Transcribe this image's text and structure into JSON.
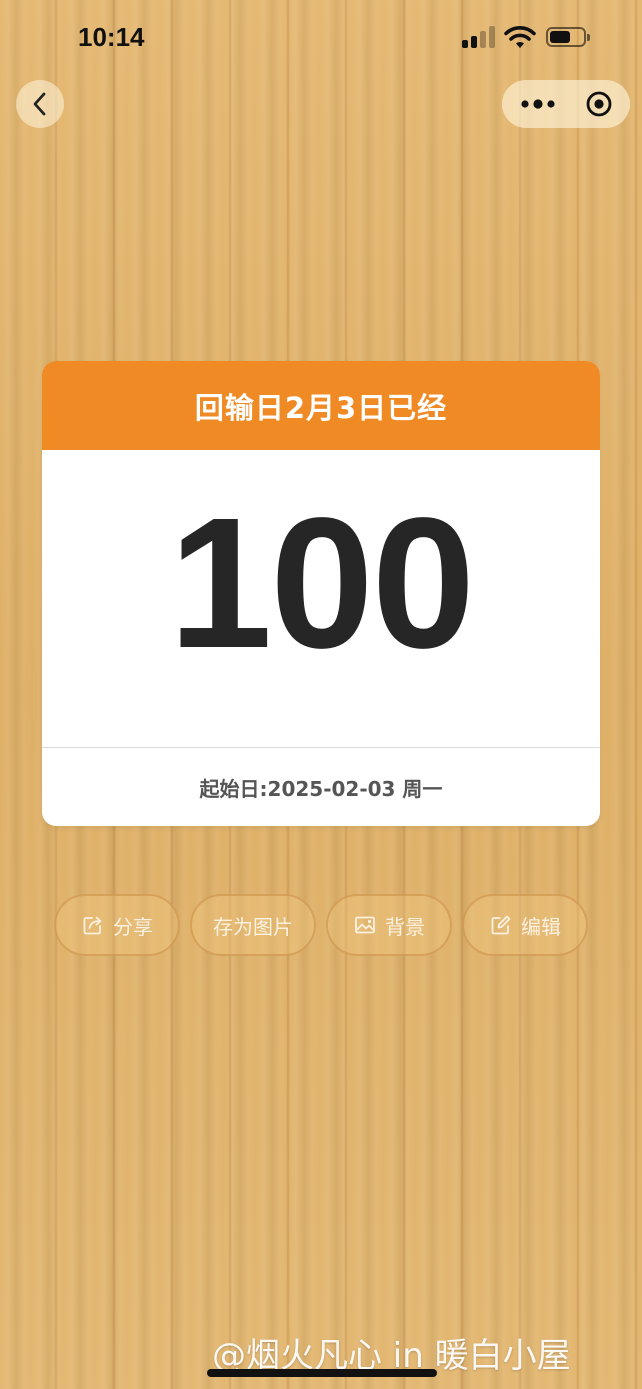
{
  "status_bar": {
    "time": "10:14",
    "signal_icon": "cellular-signal-icon",
    "wifi_icon": "wifi-icon",
    "battery_icon": "battery-icon",
    "battery_level": 0.55
  },
  "nav": {
    "back_icon": "chevron-left-icon",
    "more_icon": "more-dots-icon",
    "close_icon": "target-circle-icon"
  },
  "card": {
    "title": "回输日2月3日已经",
    "days": "100",
    "start_label": "起始日:2025-02-03 周一",
    "header_color": "#ef8a25"
  },
  "actions": [
    {
      "label": "分享",
      "icon": "share-icon"
    },
    {
      "label": "存为图片",
      "icon": ""
    },
    {
      "label": "背景",
      "icon": "image-icon"
    },
    {
      "label": "编辑",
      "icon": "edit-icon"
    }
  ],
  "watermark": "@烟火凡心 in 暖白小屋"
}
